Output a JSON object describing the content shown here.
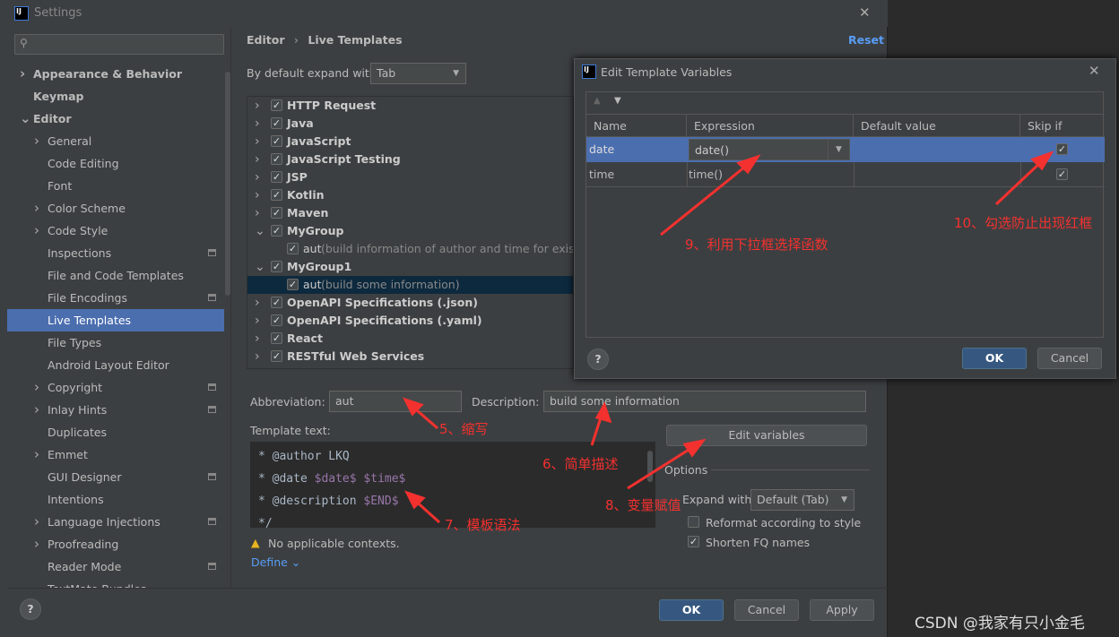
{
  "window": {
    "title": "Settings",
    "close": "✕"
  },
  "sidebar": {
    "items": [
      {
        "label": "Appearance & Behavior",
        "level": 0,
        "chevron": "right",
        "bold": true
      },
      {
        "label": "Keymap",
        "level": 0,
        "bold": true
      },
      {
        "label": "Editor",
        "level": 0,
        "chevron": "down",
        "bold": true
      },
      {
        "label": "General",
        "level": 1,
        "chevron": "right"
      },
      {
        "label": "Code Editing",
        "level": 1
      },
      {
        "label": "Font",
        "level": 1
      },
      {
        "label": "Color Scheme",
        "level": 1,
        "chevron": "right"
      },
      {
        "label": "Code Style",
        "level": 1,
        "chevron": "right"
      },
      {
        "label": "Inspections",
        "level": 1,
        "icon": true
      },
      {
        "label": "File and Code Templates",
        "level": 1
      },
      {
        "label": "File Encodings",
        "level": 1,
        "icon": true
      },
      {
        "label": "Live Templates",
        "level": 1,
        "selected": true
      },
      {
        "label": "File Types",
        "level": 1
      },
      {
        "label": "Android Layout Editor",
        "level": 1
      },
      {
        "label": "Copyright",
        "level": 1,
        "chevron": "right",
        "icon": true
      },
      {
        "label": "Inlay Hints",
        "level": 1,
        "chevron": "right",
        "icon": true
      },
      {
        "label": "Duplicates",
        "level": 1
      },
      {
        "label": "Emmet",
        "level": 1,
        "chevron": "right"
      },
      {
        "label": "GUI Designer",
        "level": 1,
        "icon": true
      },
      {
        "label": "Intentions",
        "level": 1
      },
      {
        "label": "Language Injections",
        "level": 1,
        "chevron": "right",
        "icon": true
      },
      {
        "label": "Proofreading",
        "level": 1,
        "chevron": "right"
      },
      {
        "label": "Reader Mode",
        "level": 1,
        "icon": true
      },
      {
        "label": "TextMate Bundles",
        "level": 1
      }
    ]
  },
  "main": {
    "breadcrumb": [
      "Editor",
      "Live Templates"
    ],
    "reset": "Reset",
    "expand_label": "By default expand with",
    "expand_value": "Tab",
    "tree": [
      {
        "label": "HTTP Request",
        "group": true,
        "expanded": false
      },
      {
        "label": "Java",
        "group": true
      },
      {
        "label": "JavaScript",
        "group": true
      },
      {
        "label": "JavaScript Testing",
        "group": true
      },
      {
        "label": "JSP",
        "group": true
      },
      {
        "label": "Kotlin",
        "group": true
      },
      {
        "label": "Maven",
        "group": true
      },
      {
        "label": "MyGroup",
        "group": true,
        "expanded": true
      },
      {
        "label": "aut",
        "desc": "(build information of author and time for existed",
        "group": false
      },
      {
        "label": "MyGroup1",
        "group": true,
        "expanded": true
      },
      {
        "label": "aut",
        "desc": "(build some information)",
        "group": false,
        "selected": true
      },
      {
        "label": "OpenAPI Specifications (.json)",
        "group": true
      },
      {
        "label": "OpenAPI Specifications (.yaml)",
        "group": true
      },
      {
        "label": "React",
        "group": true
      },
      {
        "label": "RESTful Web Services",
        "group": true
      }
    ],
    "abbreviation_label": "Abbreviation:",
    "abbreviation_value": "aut",
    "description_label": "Description:",
    "description_value": "build some information",
    "template_text_label": "Template text:",
    "template_lines": [
      {
        "text": "* @author LKQ"
      },
      {
        "text": "* @date ",
        "vars": "$date$ $time$"
      },
      {
        "text": "* @description ",
        "vars": "$END$"
      },
      {
        "text": "*/"
      }
    ],
    "edit_variables": "Edit variables",
    "options_label": "Options",
    "expand_with_label": "Expand with",
    "expand_with_value": "Default (Tab)",
    "reformat_label": "Reformat according to style",
    "reformat_checked": false,
    "shorten_label": "Shorten FQ names",
    "shorten_checked": true,
    "warning": "No applicable contexts.",
    "define": "Define"
  },
  "footer": {
    "help": "?",
    "ok": "OK",
    "cancel": "Cancel",
    "apply": "Apply"
  },
  "dialog": {
    "title": "Edit Template Variables",
    "columns": [
      "Name",
      "Expression",
      "Default value",
      "Skip if defined"
    ],
    "rows": [
      {
        "name": "date",
        "expression": "date()",
        "default": "",
        "skip": true,
        "selected": true
      },
      {
        "name": "time",
        "expression": "time()",
        "default": "",
        "skip": true
      }
    ],
    "ok": "OK",
    "cancel": "Cancel",
    "help": "?"
  },
  "annotations": {
    "a5": "5、缩写",
    "a6": "6、简单描述",
    "a7": "7、模板语法",
    "a8": "8、变量赋值",
    "a9": "9、利用下拉框选择函数",
    "a10": "10、勾选防止出现红框"
  },
  "watermark": "CSDN @我家有只小金毛",
  "colors": {
    "accent": "#4b6eaf",
    "annotation": "#f3312f",
    "primary_button": "#365880",
    "link": "#589df6"
  }
}
